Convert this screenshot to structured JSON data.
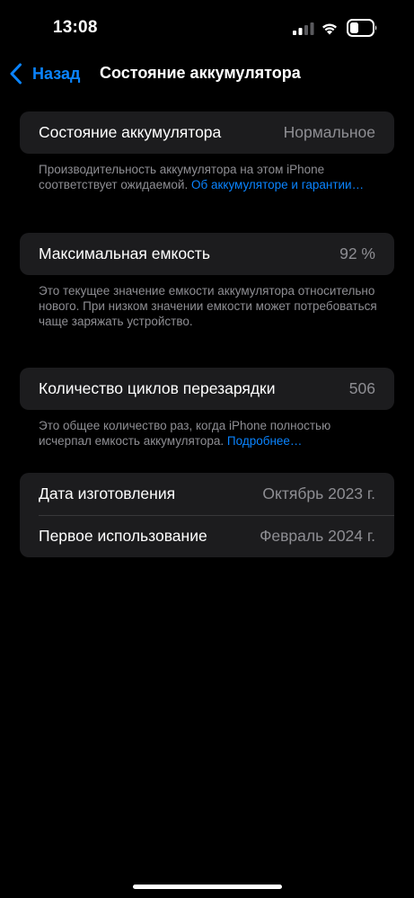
{
  "status_bar": {
    "time": "13:08"
  },
  "nav": {
    "back_label": "Назад",
    "title": "Состояние аккумулятора"
  },
  "battery_condition": {
    "label": "Состояние аккумулятора",
    "value": "Нормальное",
    "footnote": "Производительность аккумулятора на этом iPhone соответствует ожидаемой. ",
    "link": "Об аккумуляторе и гарантии…"
  },
  "max_capacity": {
    "label": "Максимальная емкость",
    "value": "92 %",
    "footnote": "Это текущее значение емкости аккумулятора относительно нового. При низком значении емкости может потребоваться чаще заряжать устройство."
  },
  "cycle_count": {
    "label": "Количество циклов перезарядки",
    "value": "506",
    "footnote": "Это общее количество раз, когда iPhone полностью исчерпал емкость аккумулятора. ",
    "link": "Подробнее…"
  },
  "dates": {
    "manufacture_label": "Дата изготовления",
    "manufacture_value": "Октябрь 2023 г.",
    "first_use_label": "Первое использование",
    "first_use_value": "Февраль 2024 г."
  },
  "colors": {
    "background": "#000000",
    "card": "#1c1c1e",
    "accent": "#0a84ff",
    "secondary_text": "#8e8e93"
  }
}
